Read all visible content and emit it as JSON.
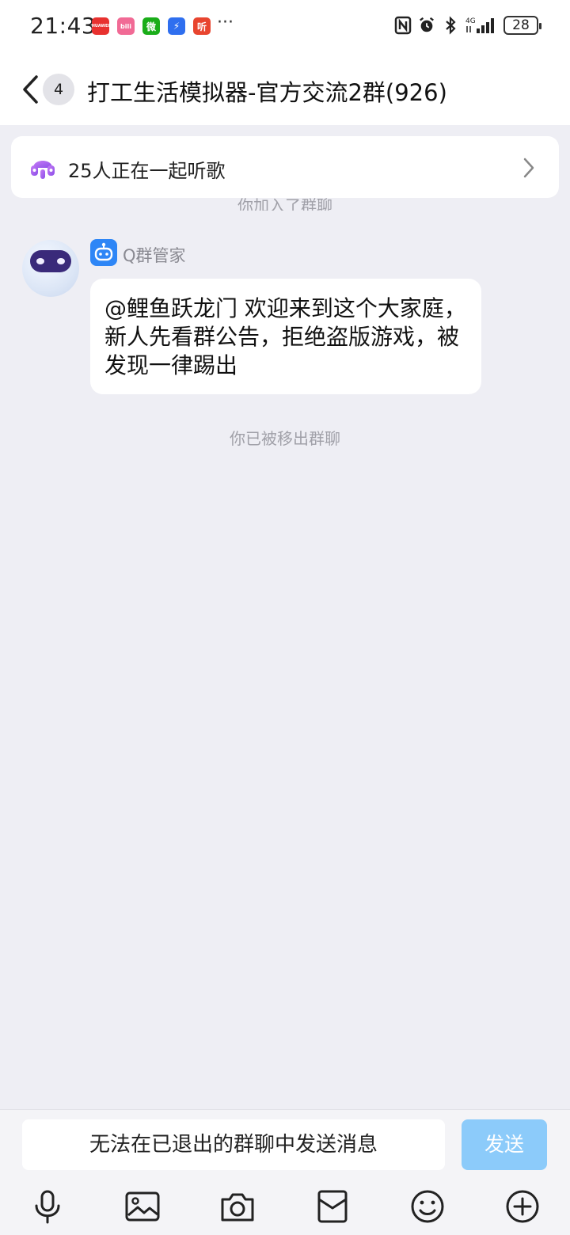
{
  "status_bar": {
    "time": "21:43",
    "more": "···",
    "battery": "28",
    "app_icons": [
      {
        "name": "huawei-app-icon",
        "label": "HUAWEI",
        "color": "#E8312F"
      },
      {
        "name": "bilibili-app-icon",
        "label": "bili",
        "color": "#F16A95"
      },
      {
        "name": "wechat-app-icon",
        "label": "微",
        "color": "#1AAD19"
      },
      {
        "name": "blue-app-icon",
        "label": "⚡",
        "color": "#2F6FEF"
      },
      {
        "name": "ting-app-icon",
        "label": "听",
        "color": "#E8452F"
      }
    ]
  },
  "header": {
    "unread_count": "4",
    "title": "打工生活模拟器-官方交流2群(926)"
  },
  "listen_card": {
    "text": "25人正在一起听歌"
  },
  "messages": {
    "joined_notice": "你加入了群聊",
    "sender_name": "Q群管家",
    "bubble_text": "@鲤鱼跃龙门 欢迎来到这个大家庭，新人先看群公告，拒绝盗版游戏，被发现一律踢出",
    "removed_notice": "你已被移出群聊"
  },
  "bottom_bar": {
    "input_placeholder": "无法在已退出的群聊中发送消息",
    "send_label": "发送",
    "tools": [
      "microphone-icon",
      "image-icon",
      "camera-icon",
      "red-packet-icon",
      "emoji-icon",
      "plus-icon"
    ]
  },
  "colors": {
    "background": "#EEEEF4",
    "accent": "#2E86F6",
    "send_disabled": "#8CCBFA"
  }
}
